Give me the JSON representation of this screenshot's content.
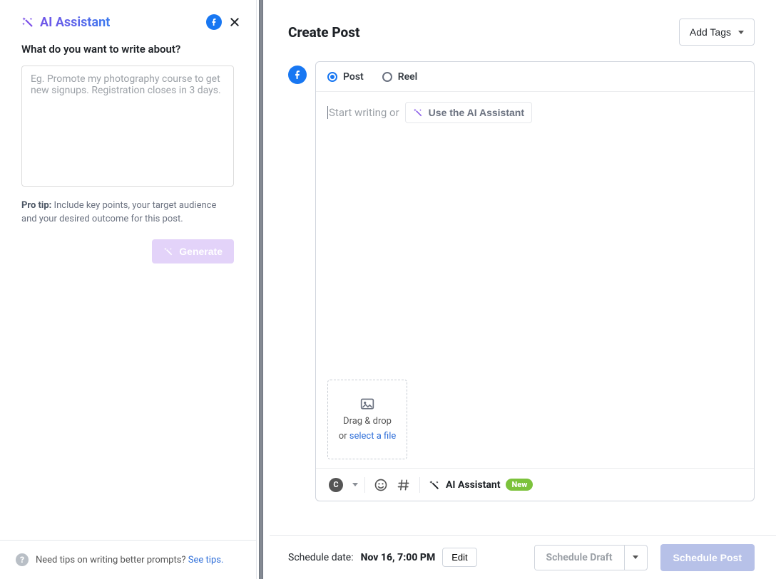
{
  "left": {
    "title": "AI Assistant",
    "networkIcon": "facebook",
    "prompt_question": "What do you want to write about?",
    "prompt_placeholder": "Eg. Promote my photography course to get new signups. Registration closes in 3 days.",
    "pro_tip_label": "Pro tip:",
    "pro_tip_text": " Include key points, your target audience and your desired outcome for this post.",
    "generate_label": "Generate",
    "footer_text": "Need tips on writing better prompts? ",
    "footer_link": "See tips."
  },
  "right": {
    "title": "Create Post",
    "add_tags_label": "Add Tags",
    "post_types": {
      "post": "Post",
      "reel": "Reel",
      "selected": "post"
    },
    "compose_placeholder": "Start writing or ",
    "use_ai_label": "Use the AI Assistant",
    "dropzone": {
      "line1": "Drag & drop",
      "line2_a": "or ",
      "line2_link": "select a file"
    },
    "toolbar": {
      "ai_label": "AI Assistant",
      "new_badge": "New",
      "canva_letter": "C"
    },
    "footer": {
      "schedule_label": "Schedule date: ",
      "schedule_value": "Nov 16, 7:00 PM",
      "edit_label": "Edit",
      "draft_label": "Schedule Draft",
      "schedule_btn": "Schedule Post"
    }
  }
}
